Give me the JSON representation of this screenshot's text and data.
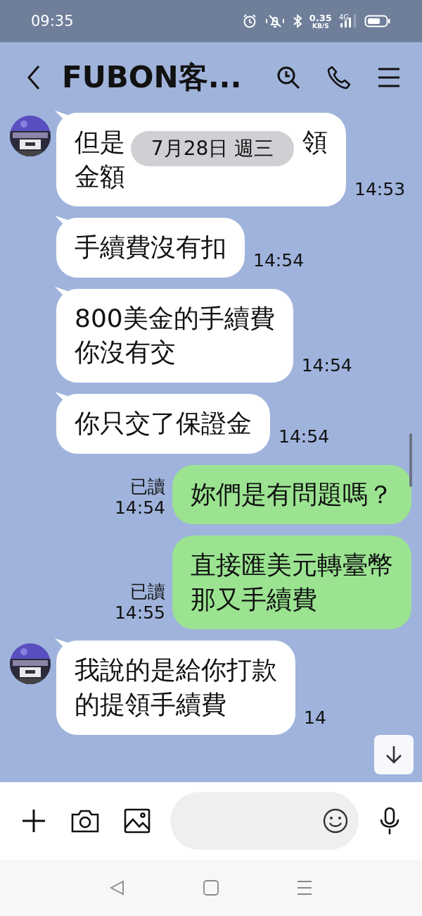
{
  "status_bar": {
    "time": "09:35",
    "net_speed": "0.35",
    "net_unit": "KB/S",
    "network": "4G"
  },
  "header": {
    "title": "FUBON客..."
  },
  "date_pill": "7月28日 週三",
  "messages": [
    {
      "kind": "received",
      "avatar": true,
      "lines": [
        [
          "但是",
          "領"
        ],
        [
          "金額"
        ]
      ],
      "time": "14:53"
    },
    {
      "kind": "received",
      "avatar": false,
      "lines": [
        [
          "手續費沒有扣"
        ]
      ],
      "time": "14:54"
    },
    {
      "kind": "received",
      "avatar": false,
      "lines": [
        [
          "800美金的手續費"
        ],
        [
          "你沒有交"
        ]
      ],
      "time": "14:54"
    },
    {
      "kind": "received",
      "avatar": false,
      "lines": [
        [
          "你只交了保證金"
        ]
      ],
      "time": "14:54"
    },
    {
      "kind": "sent",
      "read": "已讀",
      "lines": [
        [
          "妳們是有問題嗎？"
        ]
      ],
      "time": "14:54"
    },
    {
      "kind": "sent",
      "read": "已讀",
      "lines": [
        [
          "直接匯美元轉臺幣"
        ],
        [
          "那又手續費"
        ]
      ],
      "time": "14:55"
    },
    {
      "kind": "received",
      "avatar": true,
      "lines": [
        [
          "我說的是給你打款"
        ],
        [
          "的提領手續費"
        ]
      ],
      "time": "14"
    }
  ]
}
